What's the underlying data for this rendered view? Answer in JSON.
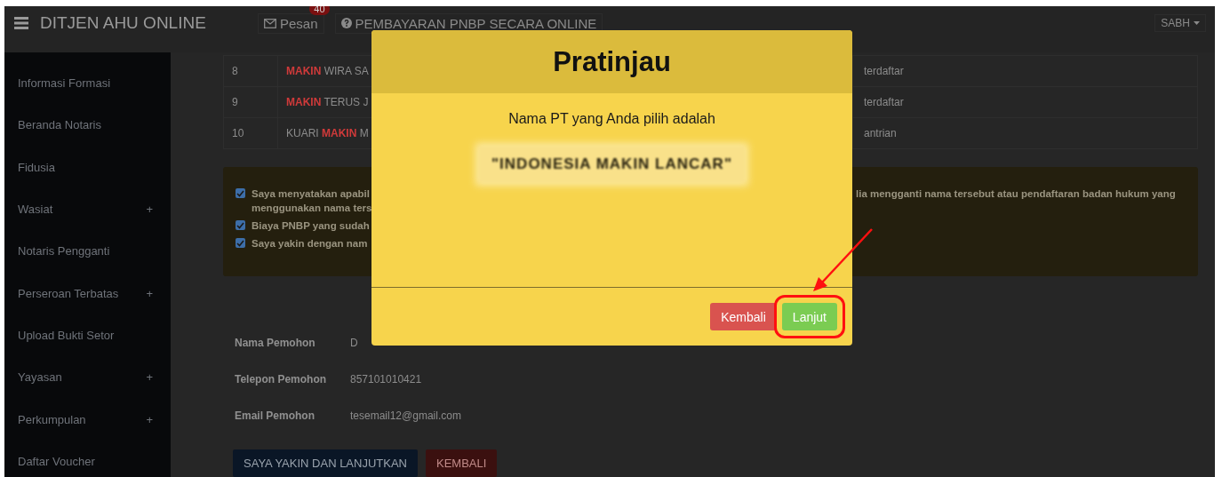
{
  "navbar": {
    "brand": "DITJEN AHU ONLINE",
    "messages": {
      "label": "Pesan",
      "badge": "40"
    },
    "payment_link": "PEMBAYARAN PNBP SECARA ONLINE",
    "user": "SABH"
  },
  "sidebar": {
    "items": [
      {
        "label": "Informasi Formasi"
      },
      {
        "label": "Beranda Notaris"
      },
      {
        "label": "Fidusia"
      },
      {
        "label": "Wasiat",
        "expander": "+"
      },
      {
        "label": "Notaris Pengganti"
      },
      {
        "label": "Perseroan Terbatas",
        "expander": "+"
      },
      {
        "label": "Upload Bukti Setor"
      },
      {
        "label": "Yayasan",
        "expander": "+"
      },
      {
        "label": "Perkumpulan",
        "expander": "+"
      },
      {
        "label": "Daftar Voucher"
      }
    ]
  },
  "table": {
    "rows": [
      {
        "no": "8",
        "name": [
          {
            "text": "MAKIN",
            "highlight": true
          },
          {
            "text": "WIRA SA",
            "highlight": false
          }
        ],
        "status": "terdaftar"
      },
      {
        "no": "9",
        "name": [
          {
            "text": "MAKIN",
            "highlight": true
          },
          {
            "text": "TERUS J",
            "highlight": false
          }
        ],
        "status": "terdaftar"
      },
      {
        "no": "10",
        "name": [
          {
            "text": "KUARI",
            "highlight": false
          },
          {
            "text": "MAKIN",
            "highlight": true
          },
          {
            "text": "M",
            "highlight": false
          }
        ],
        "status": "antrian"
      }
    ]
  },
  "agreements": [
    {
      "checked": true,
      "lines": [
        "Saya menyatakan apabil",
        "menggunakan nama ters"
      ],
      "continuation": "lia mengganti nama tersebut atau pendaftaran badan hukum yang"
    },
    {
      "checked": true,
      "lines": [
        "Biaya PNBP yang sudah"
      ]
    },
    {
      "checked": true,
      "lines": [
        "Saya yakin dengan nam"
      ]
    }
  ],
  "applicant": [
    {
      "label": "Nama Pemohon",
      "value": "D"
    },
    {
      "label": "Telepon Pemohon",
      "value": "857101010421"
    },
    {
      "label": "Email Pemohon",
      "value": "tesemail12@gmail.com"
    }
  ],
  "actions": [
    {
      "label": "SAYA YAKIN DAN LANJUTKAN",
      "kind": "primary"
    },
    {
      "label": "KEMBALI",
      "kind": "danger"
    }
  ],
  "modal": {
    "title": "Pratinjau",
    "message": "Nama PT yang Anda pilih adalah",
    "company_name": "\"INDONESIA MAKIN LANCAR\"",
    "buttons": [
      {
        "label": "Kembali",
        "kind": "danger",
        "highlighted": false
      },
      {
        "label": "Lanjut",
        "kind": "success",
        "highlighted": true
      }
    ]
  }
}
